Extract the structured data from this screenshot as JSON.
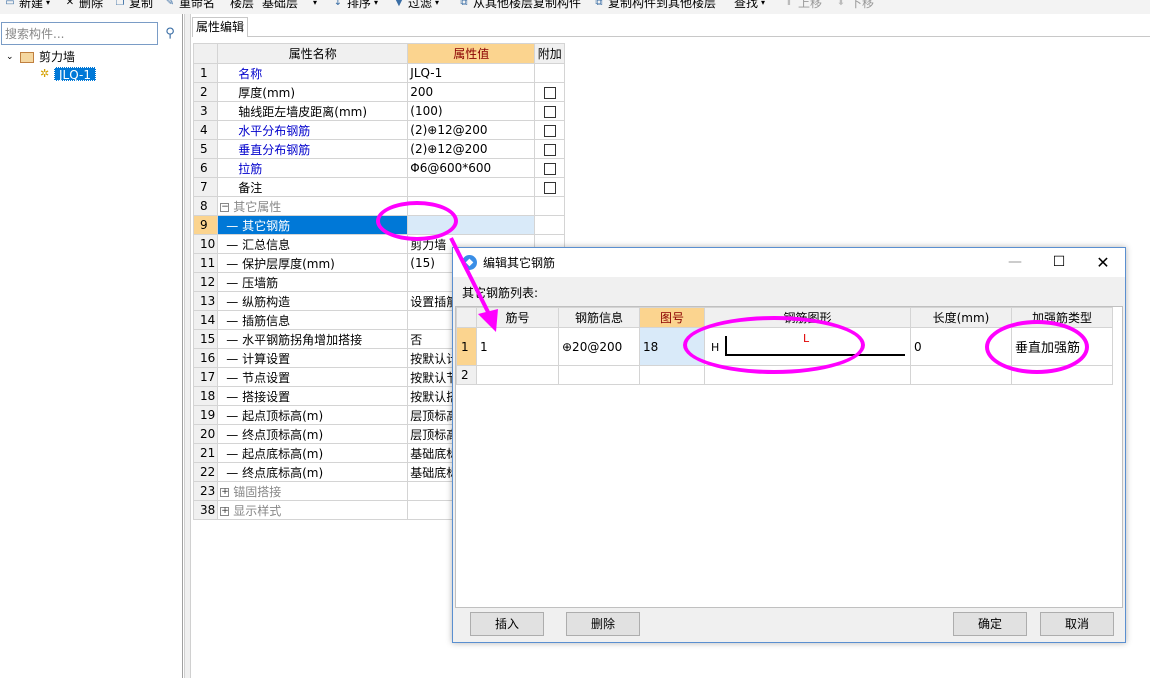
{
  "toolbar": {
    "new_label": "新建",
    "delete_label": "删除",
    "copy_label": "复制",
    "rename_label": "重命名",
    "floor_label": "楼层",
    "floor_value": "基础层",
    "sort_label": "排序",
    "filter_label": "过滤",
    "copy_from_floor_label": "从其他楼层复制构件",
    "copy_to_floor_label": "复制构件到其他楼层",
    "find_label": "查找",
    "move_up_label": "上移",
    "move_down_label": "下移"
  },
  "search": {
    "placeholder": "搜索构件..."
  },
  "tree": {
    "root_label": "剪力墙",
    "child_label": "JLQ-1"
  },
  "property_tab": {
    "label": "属性编辑"
  },
  "property_grid": {
    "headers": {
      "name": "属性名称",
      "value": "属性值",
      "extra": "附加"
    },
    "rows": [
      {
        "num": "1",
        "name": "名称",
        "value": "JLQ-1"
      },
      {
        "num": "2",
        "name": "厚度(mm)",
        "value": "200"
      },
      {
        "num": "3",
        "name": "轴线距左墙皮距离(mm)",
        "value": "(100)"
      },
      {
        "num": "4",
        "name": "水平分布钢筋",
        "value": "(2)⊕12@200"
      },
      {
        "num": "5",
        "name": "垂直分布钢筋",
        "value": "(2)⊕12@200"
      },
      {
        "num": "6",
        "name": "拉筋",
        "value": "Φ6@600*600"
      },
      {
        "num": "7",
        "name": "备注",
        "value": ""
      },
      {
        "num": "8",
        "name": "其它属性",
        "value": ""
      },
      {
        "num": "9",
        "name": "其它钢筋",
        "value": ""
      },
      {
        "num": "10",
        "name": "汇总信息",
        "value": "剪力墙"
      },
      {
        "num": "11",
        "name": "保护层厚度(mm)",
        "value": "(15)"
      },
      {
        "num": "12",
        "name": "压墙筋",
        "value": ""
      },
      {
        "num": "13",
        "name": "纵筋构造",
        "value": "设置插筋"
      },
      {
        "num": "14",
        "name": "插筋信息",
        "value": ""
      },
      {
        "num": "15",
        "name": "水平钢筋拐角增加搭接",
        "value": "否"
      },
      {
        "num": "16",
        "name": "计算设置",
        "value": "按默认计"
      },
      {
        "num": "17",
        "name": "节点设置",
        "value": "按默认节"
      },
      {
        "num": "18",
        "name": "搭接设置",
        "value": "按默认搭"
      },
      {
        "num": "19",
        "name": "起点顶标高(m)",
        "value": "层顶标高"
      },
      {
        "num": "20",
        "name": "终点顶标高(m)",
        "value": "层顶标高"
      },
      {
        "num": "21",
        "name": "起点底标高(m)",
        "value": "基础底标"
      },
      {
        "num": "22",
        "name": "终点底标高(m)",
        "value": "基础底标"
      },
      {
        "num": "23",
        "name": "锚固搭接",
        "value": ""
      },
      {
        "num": "38",
        "name": "显示样式",
        "value": ""
      }
    ]
  },
  "dialog": {
    "title": "编辑其它钢筋",
    "list_label": "其它钢筋列表:",
    "headers": {
      "bar_no": "筋号",
      "bar_info": "钢筋信息",
      "fig_no": "图号",
      "shape": "钢筋图形",
      "length": "长度(mm)",
      "type": "加强筋类型"
    },
    "rows": [
      {
        "num": "1",
        "bar_no": "1",
        "bar_info": "⊕20@200",
        "fig_no": "18",
        "shape_h": "H",
        "shape_l": "L",
        "length": "0",
        "type": "垂直加强筋"
      },
      {
        "num": "2",
        "bar_no": "",
        "bar_info": "",
        "fig_no": "",
        "shape_h": "",
        "shape_l": "",
        "length": "",
        "type": ""
      }
    ],
    "insert_label": "插入",
    "delete_label": "删除",
    "ok_label": "确定",
    "cancel_label": "取消",
    "annotation_color": "#ff00ff",
    "selection_color": "#0078d7"
  }
}
